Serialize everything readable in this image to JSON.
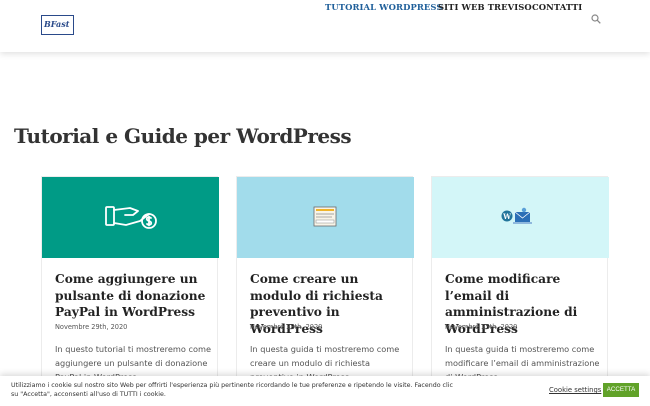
{
  "header": {
    "logo_text": "BFast",
    "nav": [
      {
        "label": "TUTORIAL WORDPRESS",
        "active": true
      },
      {
        "label": "SITI WEB TREVISO",
        "active": false
      },
      {
        "label": "CONTATTI",
        "active": false
      }
    ]
  },
  "main": {
    "title": "Tutorial e Guide per WordPress",
    "cards": [
      {
        "image_bg": "#009b86",
        "icon": "hand-coin-icon",
        "title": "Come aggiungere un pulsante di donazione PayPal in WordPress",
        "date": "Novembre 29th, 2020",
        "excerpt": "In questo tutorial ti mostreremo come aggiungere un pulsante di donazione PayPal in WordPress"
      },
      {
        "image_bg": "#a2dceb",
        "icon": "form-icon",
        "title": "Come creare un modulo di richiesta preventivo in WordPress",
        "date": "Novembre 28th, 2020",
        "excerpt": "In questa guida ti mostreremo come creare un modulo di richiesta preventivo in WordPress"
      },
      {
        "image_bg": "#d3f6f8",
        "icon": "wordpress-email-icon",
        "title": "Come modificare l’email di amministrazione di WordPress",
        "date": "Novembre 25th, 2020",
        "excerpt": "In questa guida ti mostreremo come modificare l’email di amministrazione di WordPress"
      }
    ]
  },
  "cookie": {
    "text": "Utilizziamo i cookie sul nostro sito Web per offrirti l'esperienza più pertinente ricordando le tue preferenze e ripetendo le visite. Facendo clic su \"Accetta\", acconsenti all'uso di TUTTI i cookie.",
    "settings_label": "Cookie settings",
    "accept_label": "ACCETTA"
  }
}
